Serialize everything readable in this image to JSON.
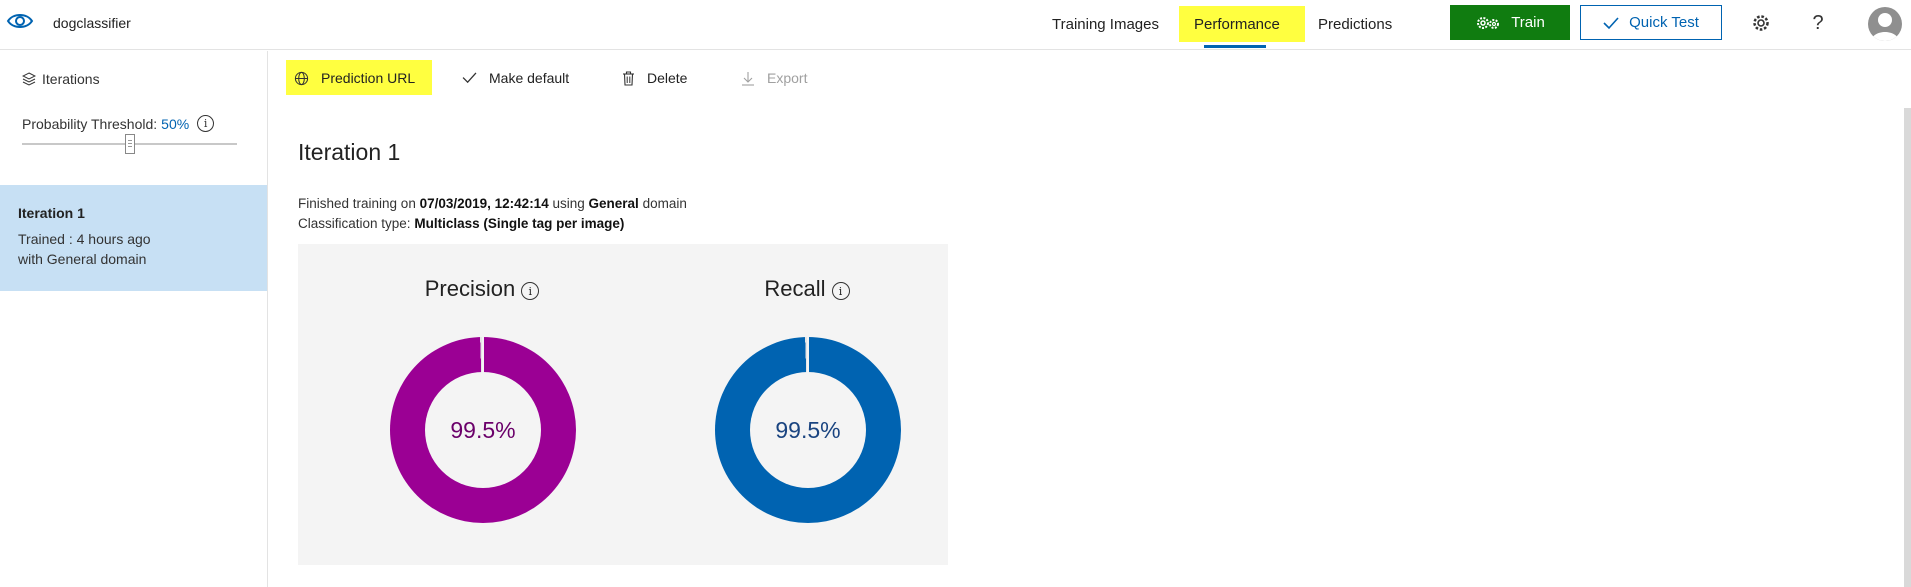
{
  "header": {
    "app_name": "dogclassifier",
    "tabs": [
      {
        "label": "Training Images"
      },
      {
        "label": "Performance"
      },
      {
        "label": "Predictions"
      }
    ],
    "train_label": "Train",
    "quick_test_label": "Quick Test",
    "settings_icon": "gear-icon",
    "help_label": "?"
  },
  "sidebar": {
    "iterations_label": "Iterations",
    "threshold_label": "Probability Threshold:",
    "threshold_value": "50%",
    "threshold_fraction": 0.5,
    "info_glyph": "i",
    "iteration": {
      "name": "Iteration 1",
      "trained": "Trained : 4 hours ago",
      "domain": "with General domain"
    }
  },
  "toolbar": {
    "prediction_url": "Prediction URL",
    "make_default": "Make default",
    "delete": "Delete",
    "export": "Export"
  },
  "main": {
    "title": "Iteration 1",
    "finished_prefix": "Finished training on",
    "finished_date": "07/03/2019, 12:42:14",
    "finished_using": "using",
    "finished_domain": "General",
    "finished_suffix": "domain",
    "classification_prefix": "Classification type:",
    "classification_value": "Multiclass (Single tag per image)",
    "precision": {
      "label": "Precision",
      "value": "99.5%",
      "fraction": 0.995,
      "color": "#9b0094"
    },
    "recall": {
      "label": "Recall",
      "value": "99.5%",
      "fraction": 0.995,
      "color": "#0063b1"
    }
  },
  "colors": {
    "accent": "#0063b1",
    "train_button": "#107c10",
    "highlight": "#ffff40",
    "selected_item": "#c7e0f4",
    "precision_text": "#6b006a",
    "recall_text": "#1a4480"
  }
}
